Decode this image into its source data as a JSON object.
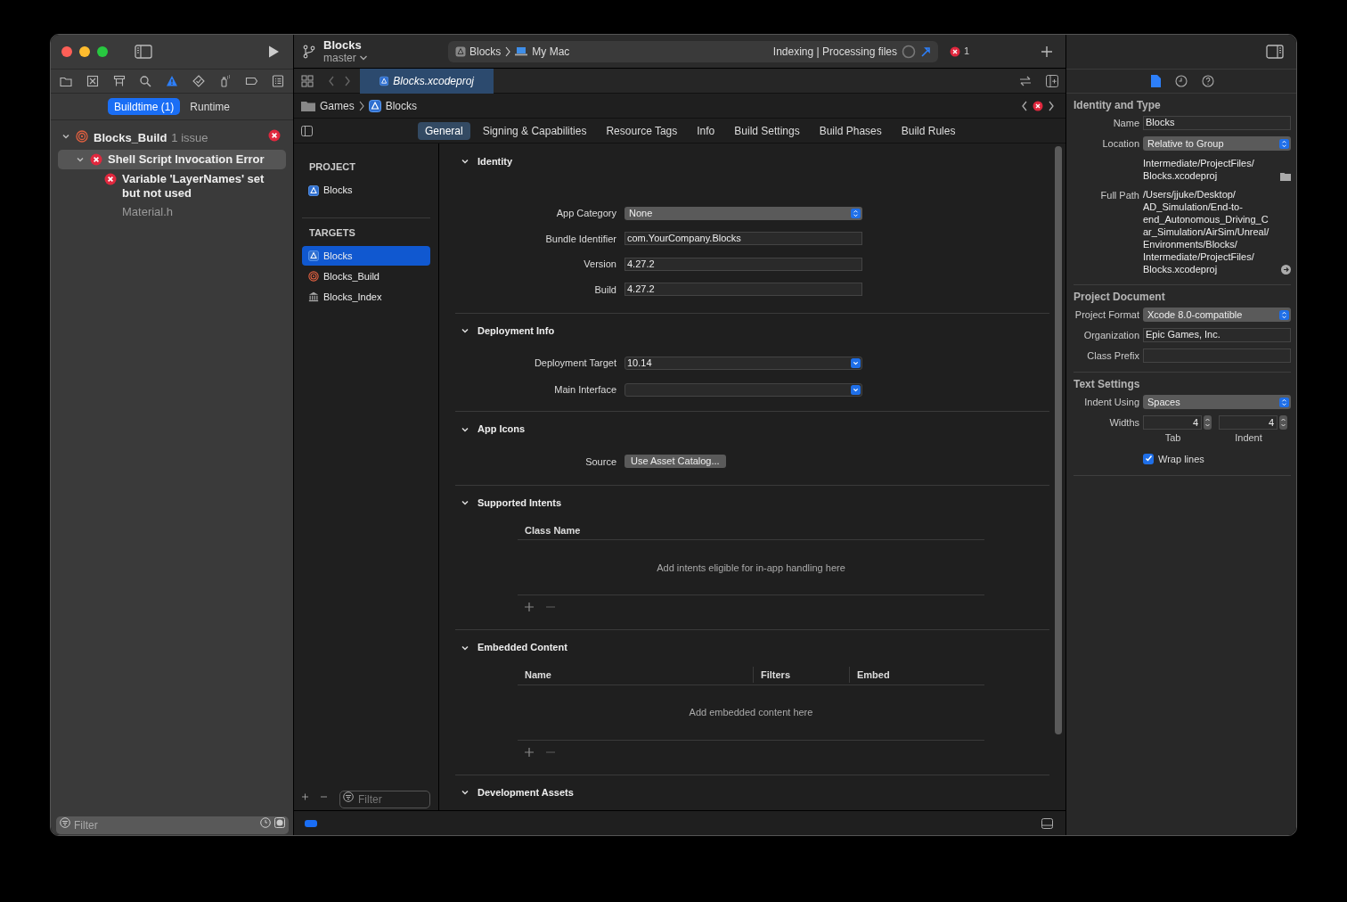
{
  "toolbar": {
    "project": "Blocks",
    "branch": "master",
    "scheme": "Blocks",
    "destination": "My Mac",
    "activity": "Indexing | Processing files",
    "error_count": "1"
  },
  "navigator": {
    "tabs": [
      {
        "selected": false
      },
      {
        "selected": false
      },
      {
        "selected": false
      },
      {
        "selected": false
      },
      {
        "selected": true
      },
      {
        "selected": false
      },
      {
        "selected": false
      },
      {
        "selected": false
      },
      {
        "selected": false
      }
    ],
    "scopes": [
      {
        "label": "Buildtime (1)",
        "selected": true
      },
      {
        "label": "Runtime",
        "selected": false
      }
    ],
    "issues": [
      {
        "kind": "target",
        "title": "Blocks_Build",
        "count": "1 issue",
        "expanded": true,
        "selected": false,
        "children": [
          {
            "kind": "error",
            "title": "Shell Script Invocation Error",
            "expanded": true,
            "selected": true,
            "children": [
              {
                "kind": "error",
                "title": "Variable 'LayerNames' set but not used",
                "file": "Material.h",
                "selected": false
              }
            ]
          }
        ]
      }
    ],
    "filter": {
      "placeholder": "Filter"
    }
  },
  "editor": {
    "tab": "Blocks.xcodeproj",
    "breadcrumb": [
      "Games",
      "Blocks"
    ],
    "settings_tabs": [
      {
        "label": "General",
        "selected": true
      },
      {
        "label": "Signing & Capabilities",
        "selected": false
      },
      {
        "label": "Resource Tags",
        "selected": false
      },
      {
        "label": "Info",
        "selected": false
      },
      {
        "label": "Build Settings",
        "selected": false
      },
      {
        "label": "Build Phases",
        "selected": false
      },
      {
        "label": "Build Rules",
        "selected": false
      }
    ],
    "project_list": {
      "sections": [
        {
          "title": "PROJECT",
          "items": [
            {
              "kind": "project",
              "label": "Blocks",
              "selected": false
            }
          ]
        },
        {
          "title": "TARGETS",
          "items": [
            {
              "kind": "app",
              "label": "Blocks",
              "selected": true
            },
            {
              "kind": "target",
              "label": "Blocks_Build",
              "selected": false
            },
            {
              "kind": "index",
              "label": "Blocks_Index",
              "selected": false
            }
          ]
        }
      ],
      "filter": {
        "placeholder": "Filter"
      }
    },
    "sections": [
      {
        "title": "Identity",
        "expanded": true,
        "rows": [
          {
            "kind": "popup",
            "label": "App Category",
            "value": "None"
          },
          {
            "kind": "text",
            "label": "Bundle Identifier",
            "value": "com.YourCompany.Blocks"
          },
          {
            "kind": "text",
            "label": "Version",
            "value": "4.27.2"
          },
          {
            "kind": "text",
            "label": "Build",
            "value": "4.27.2"
          }
        ]
      },
      {
        "title": "Deployment Info",
        "expanded": true,
        "rows": [
          {
            "kind": "combo",
            "label": "Deployment Target",
            "value": "10.14"
          },
          {
            "kind": "combo",
            "label": "Main Interface"
          }
        ]
      },
      {
        "title": "App Icons",
        "expanded": true,
        "rows": [
          {
            "kind": "button",
            "label": "Source",
            "value": "Use Asset Catalog..."
          }
        ]
      },
      {
        "title": "Supported Intents",
        "expanded": true,
        "table": {
          "columns": [
            "Class Name"
          ],
          "empty_message": "Add intents eligible for in-app handling here"
        }
      },
      {
        "title": "Embedded Content",
        "expanded": true,
        "table": {
          "columns": [
            "Name",
            "Filters",
            "Embed"
          ],
          "empty_message": "Add embedded content here"
        }
      },
      {
        "title": "Development Assets",
        "expanded": true
      }
    ]
  },
  "inspector": {
    "sections": [
      {
        "title": "Identity and Type",
        "rows": [
          {
            "kind": "text",
            "label": "Name",
            "value": "Blocks"
          },
          {
            "kind": "popup",
            "label": "Location",
            "value": "Relative to Group"
          },
          {
            "kind": "path",
            "lines": [
              "Intermediate/ProjectFiles/",
              "Blocks.xcodeproj"
            ]
          },
          {
            "kind": "path",
            "label": "Full Path",
            "lines": [
              "/Users/jjuke/Desktop/",
              "AD_Simulation/End-to-",
              "end_Autonomous_Driving_C",
              "ar_Simulation/AirSim/Unreal/",
              "Environments/Blocks/",
              "Intermediate/ProjectFiles/",
              "Blocks.xcodeproj"
            ]
          }
        ]
      },
      {
        "title": "Project Document",
        "rows": [
          {
            "kind": "popup",
            "label": "Project Format",
            "value": "Xcode 8.0-compatible"
          },
          {
            "kind": "text",
            "label": "Organization",
            "value": "Epic Games, Inc."
          },
          {
            "kind": "text",
            "label": "Class Prefix"
          }
        ]
      },
      {
        "title": "Text Settings",
        "rows": [
          {
            "kind": "popup",
            "label": "Indent Using",
            "value": "Spaces"
          },
          {
            "kind": "steppers",
            "label": "Widths",
            "fields": [
              {
                "value": "4",
                "caption": "Tab"
              },
              {
                "value": "4",
                "caption": "Indent"
              }
            ]
          },
          {
            "kind": "checkbox",
            "label": "Wrap lines",
            "checked": true
          }
        ]
      }
    ]
  }
}
